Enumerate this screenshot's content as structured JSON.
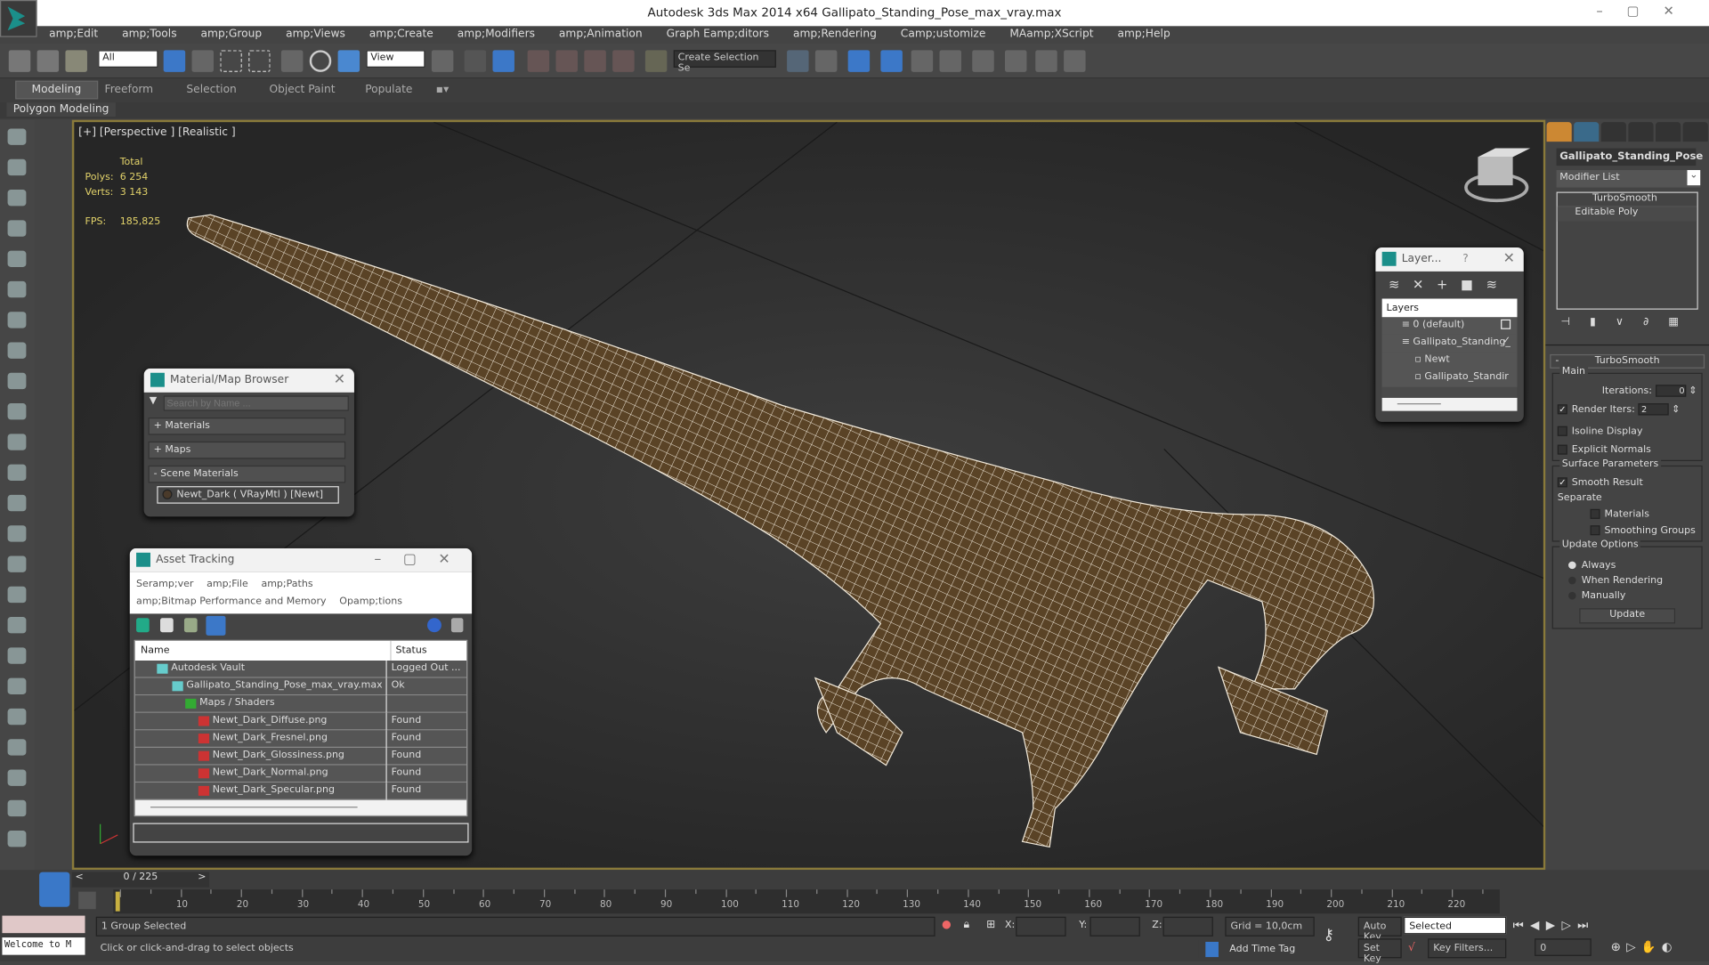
{
  "window": {
    "title": "Autodesk 3ds Max  2014 x64    Gallipato_Standing_Pose_max_vray.max"
  },
  "menu": [
    "amp;Edit",
    "amp;Tools",
    "amp;Group",
    "amp;Views",
    "amp;Create",
    "amp;Modifiers",
    "amp;Animation",
    "Graph Eamp;ditors",
    "amp;Rendering",
    "Camp;ustomize",
    "MAamp;XScript",
    "amp;Help"
  ],
  "toolbar": {
    "filter": "All",
    "ref_coord": "View",
    "selection_set": "Create Selection Se"
  },
  "ribbon": {
    "tabs": [
      "Modeling",
      "Freeform",
      "Selection",
      "Object Paint",
      "Populate"
    ],
    "sub": "Polygon Modeling"
  },
  "viewport": {
    "label": "[+] [Perspective ] [Realistic ]",
    "total": "Total",
    "polys_label": "Polys:",
    "polys": "6 254",
    "verts_label": "Verts:",
    "verts": "3 143",
    "fps_label": "FPS:",
    "fps": "185,825"
  },
  "material_browser": {
    "title": "Material/Map Browser",
    "search_placeholder": "Search by Name ...",
    "groups": [
      "+ Materials",
      "+ Maps",
      "- Scene Materials"
    ],
    "item": "Newt_Dark  ( VRayMtl )  [Newt]"
  },
  "asset_tracking": {
    "title": "Asset Tracking",
    "menu": [
      "Seramp;ver",
      "amp;File",
      "amp;Paths",
      "amp;Bitmap Performance and Memory",
      "Opamp;tions"
    ],
    "col_name": "Name",
    "col_status": "Status",
    "rows": [
      {
        "name": "Autodesk Vault",
        "status": "Logged Out ..."
      },
      {
        "name": "Gallipato_Standing_Pose_max_vray.max",
        "status": "Ok"
      },
      {
        "name": "Maps / Shaders",
        "status": ""
      },
      {
        "name": "Newt_Dark_Diffuse.png",
        "status": "Found"
      },
      {
        "name": "Newt_Dark_Fresnel.png",
        "status": "Found"
      },
      {
        "name": "Newt_Dark_Glossiness.png",
        "status": "Found"
      },
      {
        "name": "Newt_Dark_Normal.png",
        "status": "Found"
      },
      {
        "name": "Newt_Dark_Specular.png",
        "status": "Found"
      }
    ]
  },
  "layers": {
    "title": "Layer...",
    "help": "?",
    "header": "Layers",
    "items": [
      "0 (default)",
      "Gallipato_Standing_",
      "Newt",
      "Gallipato_Standir"
    ]
  },
  "command_panel": {
    "object_name": "Gallipato_Standing_Pose",
    "modifier_list": "Modifier List",
    "stack": [
      "TurboSmooth",
      "Editable Poly"
    ],
    "rollout": "TurboSmooth",
    "main": "Main",
    "iterations_label": "Iterations:",
    "iterations": "0",
    "render_iters_label": "Render Iters:",
    "render_iters": "2",
    "isoline": "Isoline Display",
    "explicit": "Explicit Normals",
    "surface": "Surface Parameters",
    "smooth_result": "Smooth Result",
    "separate": "Separate",
    "materials": "Materials",
    "smoothing_groups": "Smoothing Groups",
    "update_options": "Update Options",
    "always": "Always",
    "when_rendering": "When Rendering",
    "manually": "Manually",
    "update": "Update"
  },
  "timeline": {
    "frame": "0 / 225",
    "max": 225
  },
  "status": {
    "selected": "1 Group Selected",
    "prompt": "Click or click-and-drag to select objects",
    "listener": "Welcome to M",
    "x": "X:",
    "y": "Y:",
    "z": "Z:",
    "grid": "Grid = 10,0cm",
    "add_time_tag": "Add Time Tag",
    "auto_key": "Auto Key",
    "set_key": "Set Key",
    "key_mode": "Selected",
    "key_filters": "Key Filters...",
    "frame_field": "0"
  }
}
